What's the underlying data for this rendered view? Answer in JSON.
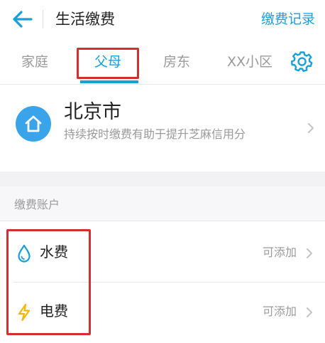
{
  "header": {
    "back_icon": "arrow-left-icon",
    "title": "生活缴费",
    "record_link": "缴费记录",
    "accent_color": "#1aa0d8"
  },
  "tabs": {
    "items": [
      {
        "label": "家庭",
        "active": false
      },
      {
        "label": "父母",
        "active": true
      },
      {
        "label": "房东",
        "active": false
      },
      {
        "label": "XX小区",
        "active": false
      }
    ],
    "settings_icon": "gear-icon",
    "highlight_color": "#d32f2f"
  },
  "city": {
    "icon": "home-icon",
    "name": "北京市",
    "description": "持续按时缴费有助于提升芝麻信用分",
    "icon_color": "#3aa4ea"
  },
  "accounts": {
    "section_title": "缴费账户",
    "items": [
      {
        "icon": "water-drop-icon",
        "label": "水费",
        "action": "可添加"
      },
      {
        "icon": "lightning-icon",
        "label": "电费",
        "action": "可添加"
      }
    ],
    "water_icon_color": "#1aa0d8",
    "electric_icon_color": "#f2b705"
  }
}
